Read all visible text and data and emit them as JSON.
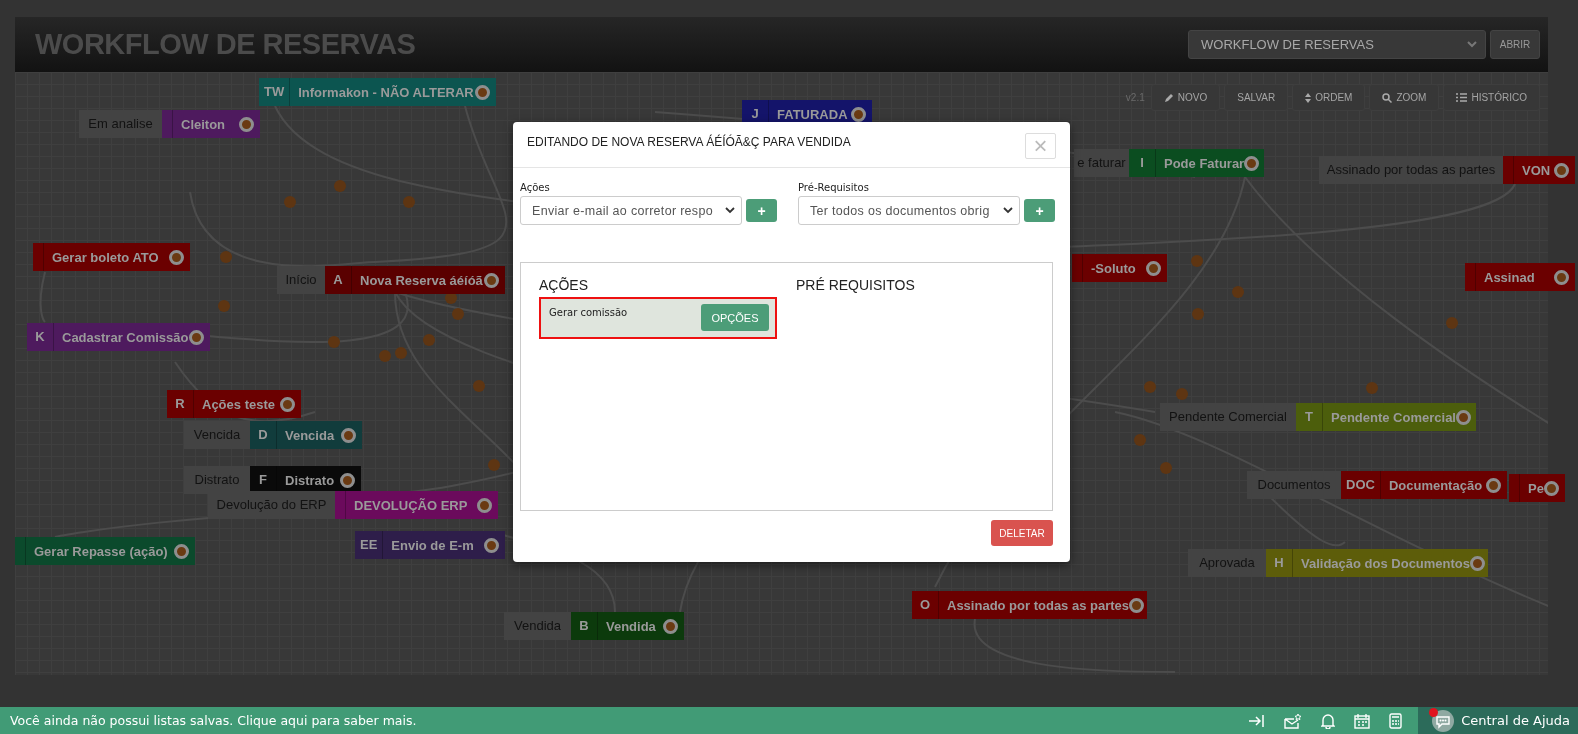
{
  "header": {
    "title": "WORKFLOW DE RESERVAS",
    "workflow_select": {
      "value": "WORKFLOW DE RESERVAS"
    },
    "open_button": "ABRIR"
  },
  "toolbar": {
    "version": "v2.1",
    "buttons": [
      {
        "label": "NOVO",
        "kind": "edit"
      },
      {
        "label": "SALVAR",
        "kind": "plain"
      },
      {
        "label": "ORDEM",
        "kind": "sort"
      },
      {
        "label": "ZOOM",
        "kind": "search"
      },
      {
        "label": "HISTÓRICO",
        "kind": "list"
      }
    ]
  },
  "nodes": [
    {
      "letter": "TW",
      "title": "Informakon - NÃO ALTERAR",
      "color": "#0c5550"
    },
    {
      "label": "Em analise",
      "title": "Cleiton",
      "color": "#4e1a5e"
    },
    {
      "letter": "J",
      "title": "FATURADA",
      "color": "#14146a"
    },
    {
      "label": "e faturar",
      "letter": "I",
      "title": "Pode Faturar",
      "color": "#0b4d20"
    },
    {
      "label": "Assinado por todas as partes",
      "title": "VON",
      "color": "#6b0000"
    },
    {
      "title": "Gerar boleto ATO",
      "color": "#6b0000"
    },
    {
      "label": "Início",
      "letter": "A",
      "title": "Nova Reserva áéíóã",
      "color": "#5a0000"
    },
    {
      "title": "-Soluto",
      "color": "#6b0000"
    },
    {
      "title": "Assinad",
      "color": "#6b0000"
    },
    {
      "letter": "K",
      "title": "Cadastrar Comissão",
      "color": "#4e1a5e"
    },
    {
      "letter": "R",
      "title": "Ações teste",
      "color": "#6b0000"
    },
    {
      "label": "Vencida",
      "letter": "D",
      "title": "Vencida",
      "color": "#113c3c"
    },
    {
      "label": "Distrato",
      "letter": "F",
      "title": "Distrato",
      "color": "#0a0a0a"
    },
    {
      "label": "Devolução do ERP",
      "title": "DEVOLUÇÃO ERP",
      "color": "#6b0a5c"
    },
    {
      "title": "Gerar Repasse (ação)",
      "color": "#0b4a2c"
    },
    {
      "letter": "EE",
      "title": "Envio de E-m",
      "color": "#2e1e4a"
    },
    {
      "label": "Vendida",
      "letter": "B",
      "title": "Vendida",
      "color": "#0c3a0c"
    },
    {
      "label": "Pendente Comercial",
      "letter": "T",
      "title": "Pendente Comercial",
      "color": "#4c5e0c"
    },
    {
      "label": "Documentos",
      "letter": "DOC",
      "title": "Documentação",
      "color": "#6b0000"
    },
    {
      "title": "Pe",
      "color": "#6b0000"
    },
    {
      "label": "Aprovada",
      "letter": "H",
      "title": "Validação dos Documentos",
      "color": "#5d5d0a"
    },
    {
      "letter": "O",
      "title": "Assinado por todas as partes",
      "color": "#6b0000"
    }
  ],
  "modal": {
    "title": "EDITANDO DE NOVA RESERVA ÁÉÍÓÃ&Ç PARA VENDIDA",
    "close": "×",
    "actions_field": {
      "label": "Ações",
      "value": "Enviar e-mail ao corretor respo",
      "add": "+"
    },
    "prereq_field": {
      "label": "Pré-Requisitos",
      "value": "Ter todos os documentos obrig",
      "add": "+"
    },
    "actions_heading": "AÇÕES",
    "prereq_heading": "PRÉ REQUISITOS",
    "actions": [
      {
        "text": "Gerar comissão",
        "button": "OPÇÕES",
        "selected": true
      }
    ],
    "delete_button": "DELETAR"
  },
  "status_bar": {
    "message": "Você ainda não possui listas salvas. Clique aqui para saber mais.",
    "help": "Central de Ajuda",
    "has_notification": true
  }
}
